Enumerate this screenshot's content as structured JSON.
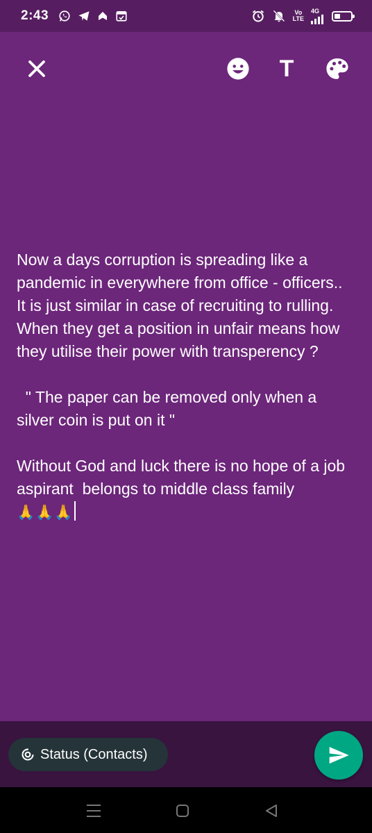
{
  "status_bar": {
    "time": "2:43",
    "left_icons": [
      "whatsapp-icon",
      "telegram-icon",
      "notification-icon",
      "calendar-icon"
    ],
    "volte_label_top": "Vo",
    "volte_label_bottom": "LTE",
    "network_label": "4G",
    "battery_level": 0.35
  },
  "toolbar": {
    "close_icon": "close-icon",
    "emoji_icon": "emoji-icon",
    "text_style_label": "T",
    "palette_icon": "palette-icon"
  },
  "status": {
    "background_color": "#6c267a",
    "paragraph_1": "Now a days corruption is spreading like a pandemic in everywhere from office - officers..",
    "paragraph_2": "It is just similar in case of recruiting to rulling. When they get a position in unfair means how they utilise their power with transperency ?",
    "paragraph_3": "  \" The paper can be removed only when a silver coin is put on it \"",
    "paragraph_4": "Without God and luck there is no hope of a job aspirant  belongs to middle class family",
    "paragraph_4_emoji": "🙏🙏🙏"
  },
  "bottom_bar": {
    "audience_label": "Status (Contacts)",
    "send_color": "#00a783"
  },
  "nav_bar": {
    "icons": [
      "recents-icon",
      "home-icon",
      "back-icon"
    ]
  }
}
